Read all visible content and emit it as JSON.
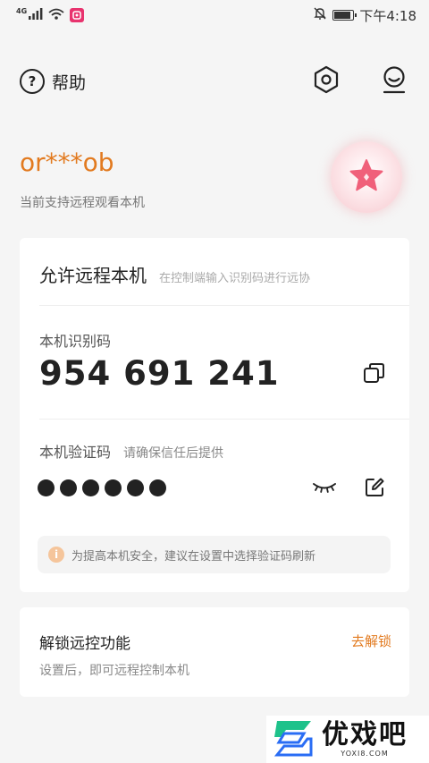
{
  "status_bar": {
    "network": "4G",
    "time": "下午4:18",
    "battery_level": 0.9
  },
  "header": {
    "help_label": "帮助",
    "help_glyph": "?",
    "icons": [
      "help-icon",
      "settings-icon",
      "profile-icon"
    ]
  },
  "account": {
    "name": "or***ob",
    "subtitle": "当前支持远程观看本机"
  },
  "remote": {
    "title": "允许远程本机",
    "hint": "在控制端输入识别码进行远协",
    "id_label": "本机识别码",
    "id_code": "954 691 241",
    "verify_label": "本机验证码",
    "verify_hint": "请确保信任后提供",
    "masked_length": 6,
    "tip_glyph": "i",
    "tip": "为提高本机安全，建议在设置中选择验证码刷新"
  },
  "unlock": {
    "title": "解锁远控功能",
    "action": "去解锁",
    "subtitle": "设置后，即可远程控制本机"
  },
  "watermark": {
    "main": "优戏吧",
    "sub": "YOXI8.COM"
  },
  "colors": {
    "accent": "#e27a1f",
    "background": "#f5f5f5",
    "card": "#ffffff",
    "badge": "#e8336e",
    "star": "#f0607a",
    "watermark_green": "#1ec28b",
    "watermark_blue": "#2a6df4"
  }
}
